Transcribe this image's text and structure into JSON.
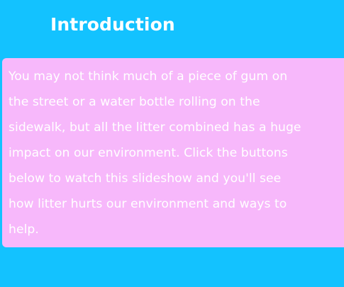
{
  "slide": {
    "title": "Introduction",
    "body_lines": [
      "You may not think much of a piece of gum on",
      "the street or a water bottle rolling on the",
      "sidewalk, but all the litter combined has a huge",
      "impact on our environment. Click the buttons",
      "below to watch this slideshow and you'll see",
      "how litter hurts our environment and ways to",
      "help."
    ]
  },
  "colors": {
    "background": "#13C2FF",
    "panel": "#F7B8FB",
    "text": "#FFFFFF"
  }
}
